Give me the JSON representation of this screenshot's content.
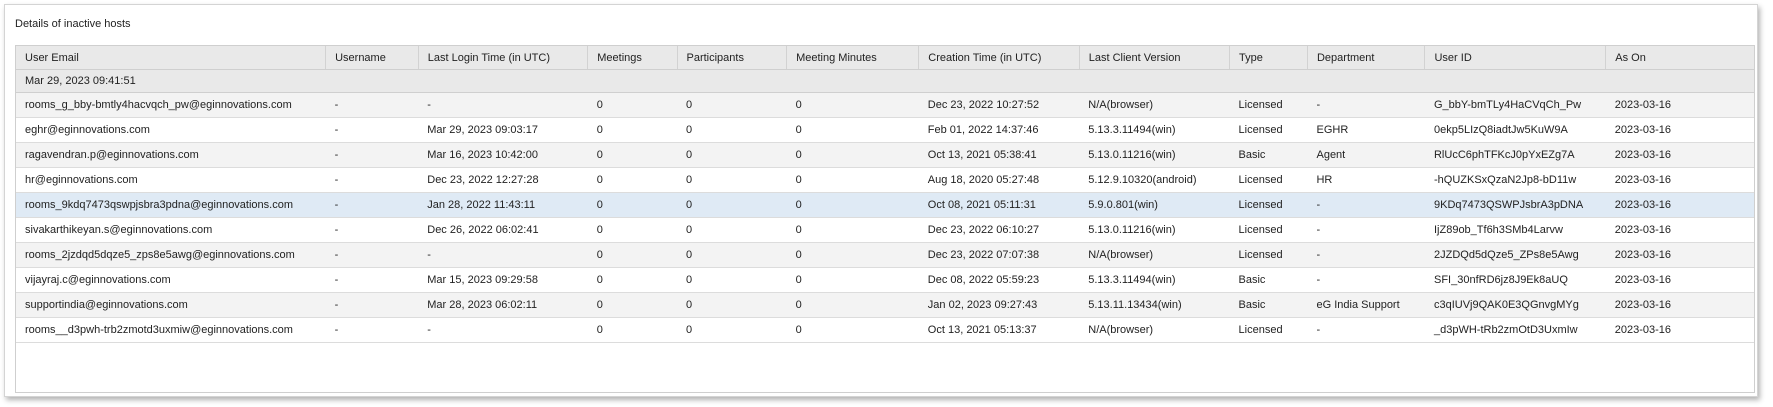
{
  "panel": {
    "title": "Details of inactive hosts"
  },
  "columns": [
    "User Email",
    "Username",
    "Last Login Time (in UTC)",
    "Meetings",
    "Participants",
    "Meeting Minutes",
    "Creation Time (in UTC)",
    "Last Client Version",
    "Type",
    "Department",
    "User ID",
    "As On"
  ],
  "group_label": "Mar 29, 2023 09:41:51",
  "selected_row_index": 4,
  "rows": [
    [
      "rooms_g_bby-bmtly4hacvqch_pw@eginnovations.com",
      "-",
      "-",
      "0",
      "0",
      "0",
      "Dec 23, 2022 10:27:52",
      "N/A(browser)",
      "Licensed",
      "-",
      "G_bbY-bmTLy4HaCVqCh_Pw",
      "2023-03-16"
    ],
    [
      "eghr@eginnovations.com",
      "-",
      "Mar 29, 2023 09:03:17",
      "0",
      "0",
      "0",
      "Feb 01, 2022 14:37:46",
      "5.13.3.11494(win)",
      "Licensed",
      "EGHR",
      "0ekp5LIzQ8iadtJw5KuW9A",
      "2023-03-16"
    ],
    [
      "ragavendran.p@eginnovations.com",
      "-",
      "Mar 16, 2023 10:42:00",
      "0",
      "0",
      "0",
      "Oct 13, 2021 05:38:41",
      "5.13.0.11216(win)",
      "Basic",
      "Agent",
      "RlUcC6phTFKcJ0pYxEZg7A",
      "2023-03-16"
    ],
    [
      "hr@eginnovations.com",
      "-",
      "Dec 23, 2022 12:27:28",
      "0",
      "0",
      "0",
      "Aug 18, 2020 05:27:48",
      "5.12.9.10320(android)",
      "Licensed",
      "HR",
      "-hQUZKSxQzaN2Jp8-bD11w",
      "2023-03-16"
    ],
    [
      "rooms_9kdq7473qswpjsbra3pdna@eginnovations.com",
      "-",
      "Jan 28, 2022 11:43:11",
      "0",
      "0",
      "0",
      "Oct 08, 2021 05:11:31",
      "5.9.0.801(win)",
      "Licensed",
      "-",
      "9KDq7473QSWPJsbrA3pDNA",
      "2023-03-16"
    ],
    [
      "sivakarthikeyan.s@eginnovations.com",
      "-",
      "Dec 26, 2022 06:02:41",
      "0",
      "0",
      "0",
      "Dec 23, 2022 06:10:27",
      "5.13.0.11216(win)",
      "Licensed",
      "-",
      "IjZ89ob_Tf6h3SMb4Larvw",
      "2023-03-16"
    ],
    [
      "rooms_2jzdqd5dqze5_zps8e5awg@eginnovations.com",
      "-",
      "-",
      "0",
      "0",
      "0",
      "Dec 23, 2022 07:07:38",
      "N/A(browser)",
      "Licensed",
      "-",
      "2JZDQd5dQze5_ZPs8e5Awg",
      "2023-03-16"
    ],
    [
      "vijayraj.c@eginnovations.com",
      "-",
      "Mar 15, 2023 09:29:58",
      "0",
      "0",
      "0",
      "Dec 08, 2022 05:59:23",
      "5.13.3.11494(win)",
      "Basic",
      "-",
      "SFI_30nfRD6jz8J9Ek8aUQ",
      "2023-03-16"
    ],
    [
      "supportindia@eginnovations.com",
      "-",
      "Mar 28, 2023 06:02:11",
      "0",
      "0",
      "0",
      "Jan 02, 2023 09:27:43",
      "5.13.11.13434(win)",
      "Basic",
      "eG India Support",
      "c3qIUVj9QAK0E3QGnvgMYg",
      "2023-03-16"
    ],
    [
      "rooms__d3pwh-trb2zmotd3uxmiw@eginnovations.com",
      "-",
      "-",
      "0",
      "0",
      "0",
      "Oct 13, 2021 05:13:37",
      "N/A(browser)",
      "Licensed",
      "-",
      "_d3pWH-tRb2zmOtD3UxmIw",
      "2023-03-16"
    ]
  ]
}
